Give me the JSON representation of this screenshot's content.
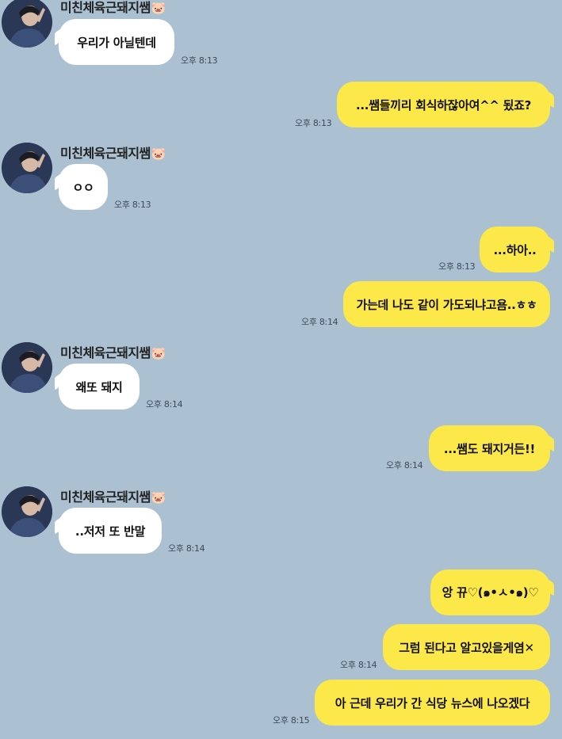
{
  "colors": {
    "background": "#abc1d1",
    "incoming_bubble": "#ffffff",
    "outgoing_bubble": "#fde84a"
  },
  "sender_name": "미친체육근돼지쌤",
  "sender_emoji": "🐷",
  "messages": [
    {
      "direction": "in",
      "text": "우리가 아닐텐데",
      "time": "오후 8:13"
    },
    {
      "direction": "out",
      "text": "...쌤들끼리 회식하잖아여^^   됬죠?",
      "time": "오후 8:13"
    },
    {
      "direction": "in",
      "text": "ㅇㅇ",
      "time": "오후 8:13"
    },
    {
      "direction": "out",
      "text": "...하아..",
      "time": "오후 8:13"
    },
    {
      "direction": "out",
      "text": "가는데 나도 같이 가도되냐고욤..ㅎㅎ",
      "time": "오후 8:14"
    },
    {
      "direction": "in",
      "text": "왜또 돼지",
      "time": "오후 8:14"
    },
    {
      "direction": "out",
      "text": "...쌤도 돼지거든!!",
      "time": "오후 8:14"
    },
    {
      "direction": "in",
      "text": "..저저 또 반말",
      "time": "오후 8:14"
    },
    {
      "direction": "out",
      "text": "앙 뀨♡(๑•ㅅ•๑)♡",
      "time": ""
    },
    {
      "direction": "out",
      "text": "그럼 된다고 알고있을게염✕",
      "time": "오후 8:14"
    },
    {
      "direction": "out",
      "text": "아 근데 우리가 간 식당 뉴스에 나오겠다",
      "time": "오후 8:15"
    }
  ]
}
